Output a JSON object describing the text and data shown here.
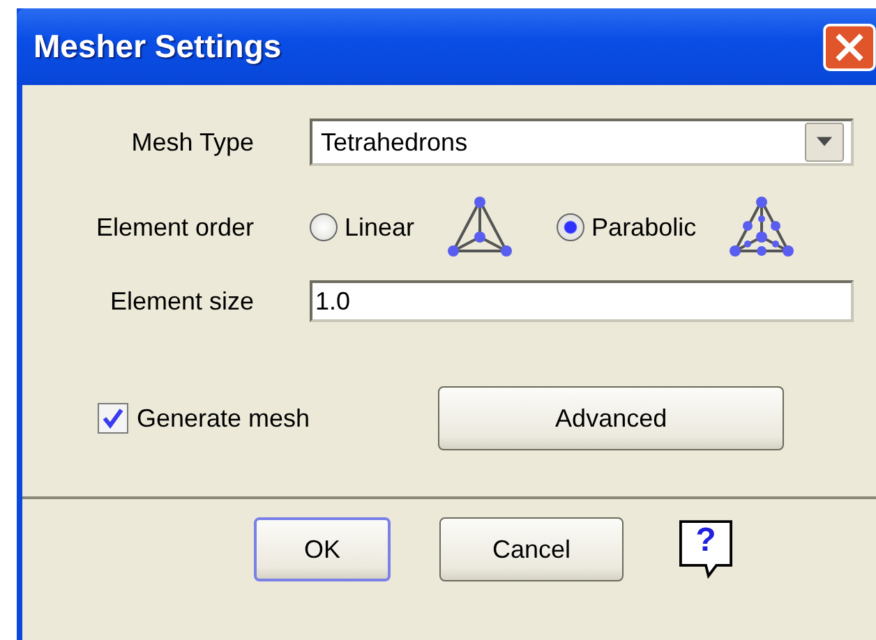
{
  "window": {
    "title": "Mesher Settings"
  },
  "mesh_type": {
    "label": "Mesh Type",
    "value": "Tetrahedrons"
  },
  "element_order": {
    "label": "Element order",
    "options": [
      {
        "label": "Linear",
        "selected": false,
        "kind": "linear"
      },
      {
        "label": "Parabolic",
        "selected": true,
        "kind": "parabolic"
      }
    ]
  },
  "element_size": {
    "label": "Element size",
    "value": "1.0"
  },
  "generate_mesh": {
    "label": "Generate mesh",
    "checked": true
  },
  "advanced_button": "Advanced",
  "buttons": [
    {
      "label": "OK",
      "kind": "default"
    },
    {
      "label": "Cancel",
      "kind": "normal"
    }
  ],
  "help": {
    "label": "?"
  }
}
